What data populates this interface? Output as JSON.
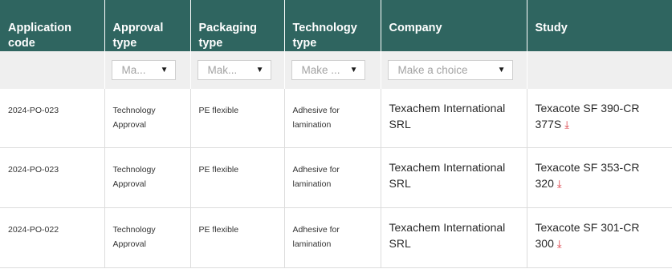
{
  "columns": [
    {
      "label": "Application code"
    },
    {
      "label": "Approval type"
    },
    {
      "label": "Packaging type"
    },
    {
      "label": "Technology type"
    },
    {
      "label": "Company"
    },
    {
      "label": "Study"
    }
  ],
  "filters": [
    {
      "selected": "Ma..."
    },
    {
      "selected": "Mak..."
    },
    {
      "selected": "Make ..."
    },
    {
      "selected": "Make a choice"
    }
  ],
  "rows": [
    {
      "code": "2024-PO-023",
      "approval": "Technology Approval",
      "packaging": "PE flexible",
      "technology": "Adhesive for lamination",
      "company": "Texachem International SRL",
      "study": "Texacote SF 390-CR 377S",
      "download_icon": "download-icon"
    },
    {
      "code": "2024-PO-023",
      "approval": "Technology Approval",
      "packaging": "PE flexible",
      "technology": "Adhesive for lamination",
      "company": "Texachem International SRL",
      "study": "Texacote SF 353-CR 320",
      "download_icon": "download-icon"
    },
    {
      "code": "2024-PO-022",
      "approval": "Technology Approval",
      "packaging": "PE flexible",
      "technology": "Adhesive for lamination",
      "company": "Texachem International SRL",
      "study": "Texacote SF 301-CR 300",
      "download_icon": "download-icon"
    }
  ],
  "colors": {
    "header_bg": "#2f6560",
    "filter_bg": "#efefef",
    "download": "#d9363e"
  }
}
